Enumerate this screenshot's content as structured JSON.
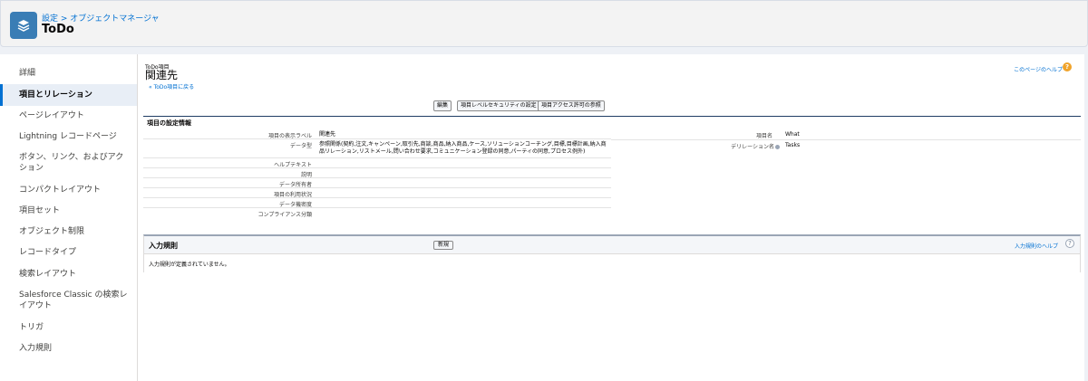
{
  "header": {
    "breadcrumb": "設定 > オブジェクトマネージャ",
    "title": "ToDo",
    "icon": "layers-icon",
    "icon_color": "#3a7db5"
  },
  "sidebar": {
    "items": [
      {
        "label": "詳細",
        "active": false
      },
      {
        "label": "項目とリレーション",
        "active": true
      },
      {
        "label": "ページレイアウト",
        "active": false
      },
      {
        "label": "Lightning レコードページ",
        "active": false
      },
      {
        "label": "ボタン、リンク、およびアクション",
        "active": false
      },
      {
        "label": "コンパクトレイアウト",
        "active": false
      },
      {
        "label": "項目セット",
        "active": false
      },
      {
        "label": "オブジェクト制限",
        "active": false
      },
      {
        "label": "レコードタイプ",
        "active": false
      },
      {
        "label": "検索レイアウト",
        "active": false
      },
      {
        "label": "Salesforce Classic の検索レイアウト",
        "active": false
      },
      {
        "label": "トリガ",
        "active": false
      },
      {
        "label": "入力規則",
        "active": false
      }
    ]
  },
  "main": {
    "object_label": "ToDo項目",
    "field_title": "関連先",
    "back_link": "« ToDo項目に戻る",
    "help_link": "このページのヘルプ",
    "buttons": {
      "edit": "編集",
      "field_security": "項目レベルセキュリティの設定",
      "field_access": "項目アクセス許可の参照"
    },
    "section_title": "項目の設定情報",
    "details": [
      {
        "label": "項目の表示ラベル",
        "value": "関連先"
      },
      {
        "label": "データ型",
        "value": "参照関係(契約,注文,キャンペーン,取引先,商談,商品,納入商品,ケース,ソリューションコーチング,目標,目標計画,納入商品リレーション,リストメール,問い合わせ要求,コミュニケーション登録の同意,パーティの同意,プロセス例外)"
      },
      {
        "label": "ヘルプテキスト",
        "value": ""
      },
      {
        "label": "説明",
        "value": ""
      },
      {
        "label": "データ所有者",
        "value": ""
      },
      {
        "label": "項目の利用状況",
        "value": ""
      },
      {
        "label": "データ機密度",
        "value": ""
      },
      {
        "label": "コンプライアンス分類",
        "value": ""
      }
    ],
    "right_details": [
      {
        "label": "項目名",
        "value": "What"
      },
      {
        "label": "デリレーション名",
        "value": "Tasks"
      }
    ]
  },
  "rules": {
    "title": "入力規則",
    "new_button": "新規",
    "help_link": "入力規則のヘルプ",
    "help_icon": "question-icon",
    "empty_text": "入力規則が定義されていません。"
  },
  "colors": {
    "link": "#0070d2",
    "help_orange": "#f0a32a",
    "section_bar": "#1f3d64"
  }
}
